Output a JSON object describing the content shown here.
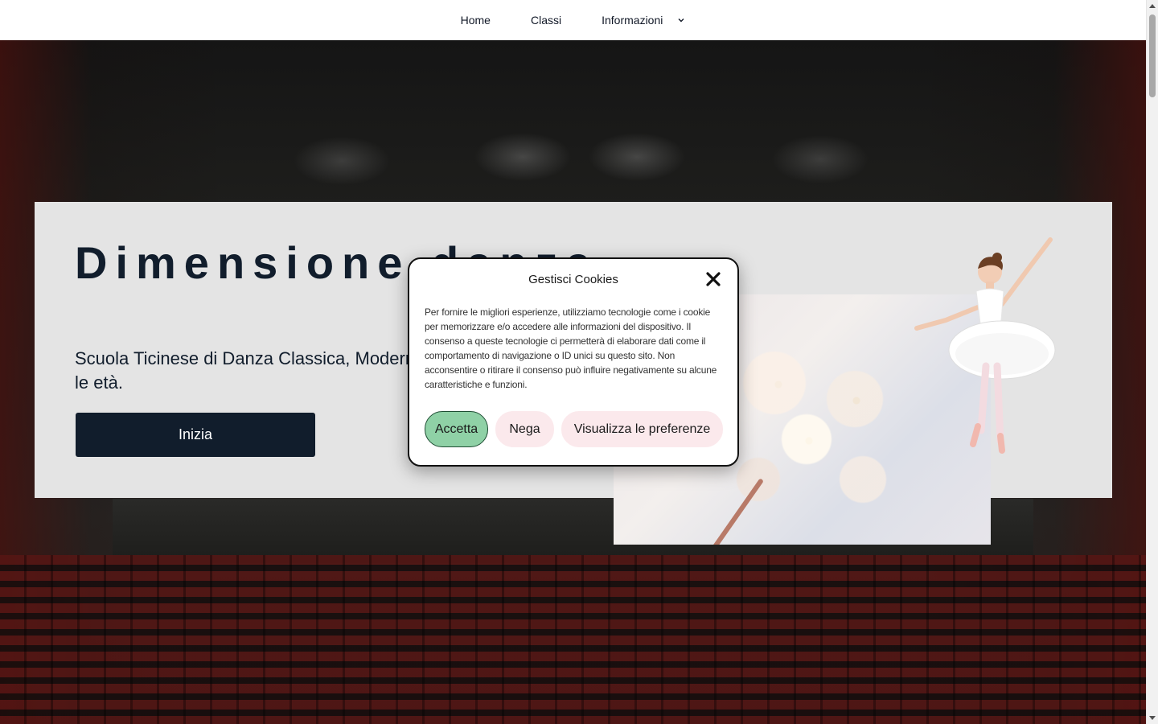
{
  "nav": {
    "items": [
      {
        "label": "Home"
      },
      {
        "label": "Classi"
      },
      {
        "label": "Informazioni",
        "has_dropdown": true
      }
    ]
  },
  "hero": {
    "title": "Dimensione danza",
    "subtitle": "Scuola Ticinese di Danza Classica, Moderna e Contemporanea per tutte",
    "subtitle_end": "le età.",
    "cta_label": "Inizia"
  },
  "cookie": {
    "title": "Gestisci Cookies",
    "body": "Per fornire le migliori esperienze, utilizziamo tecnologie come i cookie per memorizzare e/o accedere alle informazioni del dispositivo. Il consenso a queste tecnologie ci permetterà di elaborare dati come il comportamento di navigazione o ID unici su questo sito. Non acconsentire o ritirare il consenso può influire negativamente su alcune caratteristiche e funzioni.",
    "accept_label": "Accetta",
    "deny_label": "Nega",
    "prefs_label": "Visualizza le preferenze"
  },
  "colors": {
    "brand_dark": "#111d2c",
    "accept_green": "#8fd1a6",
    "deny_pink": "#fbe9ec",
    "card_bg": "#e4e4e4"
  },
  "icons": {
    "close": "close-icon",
    "dropdown": "chevron-down-icon"
  }
}
